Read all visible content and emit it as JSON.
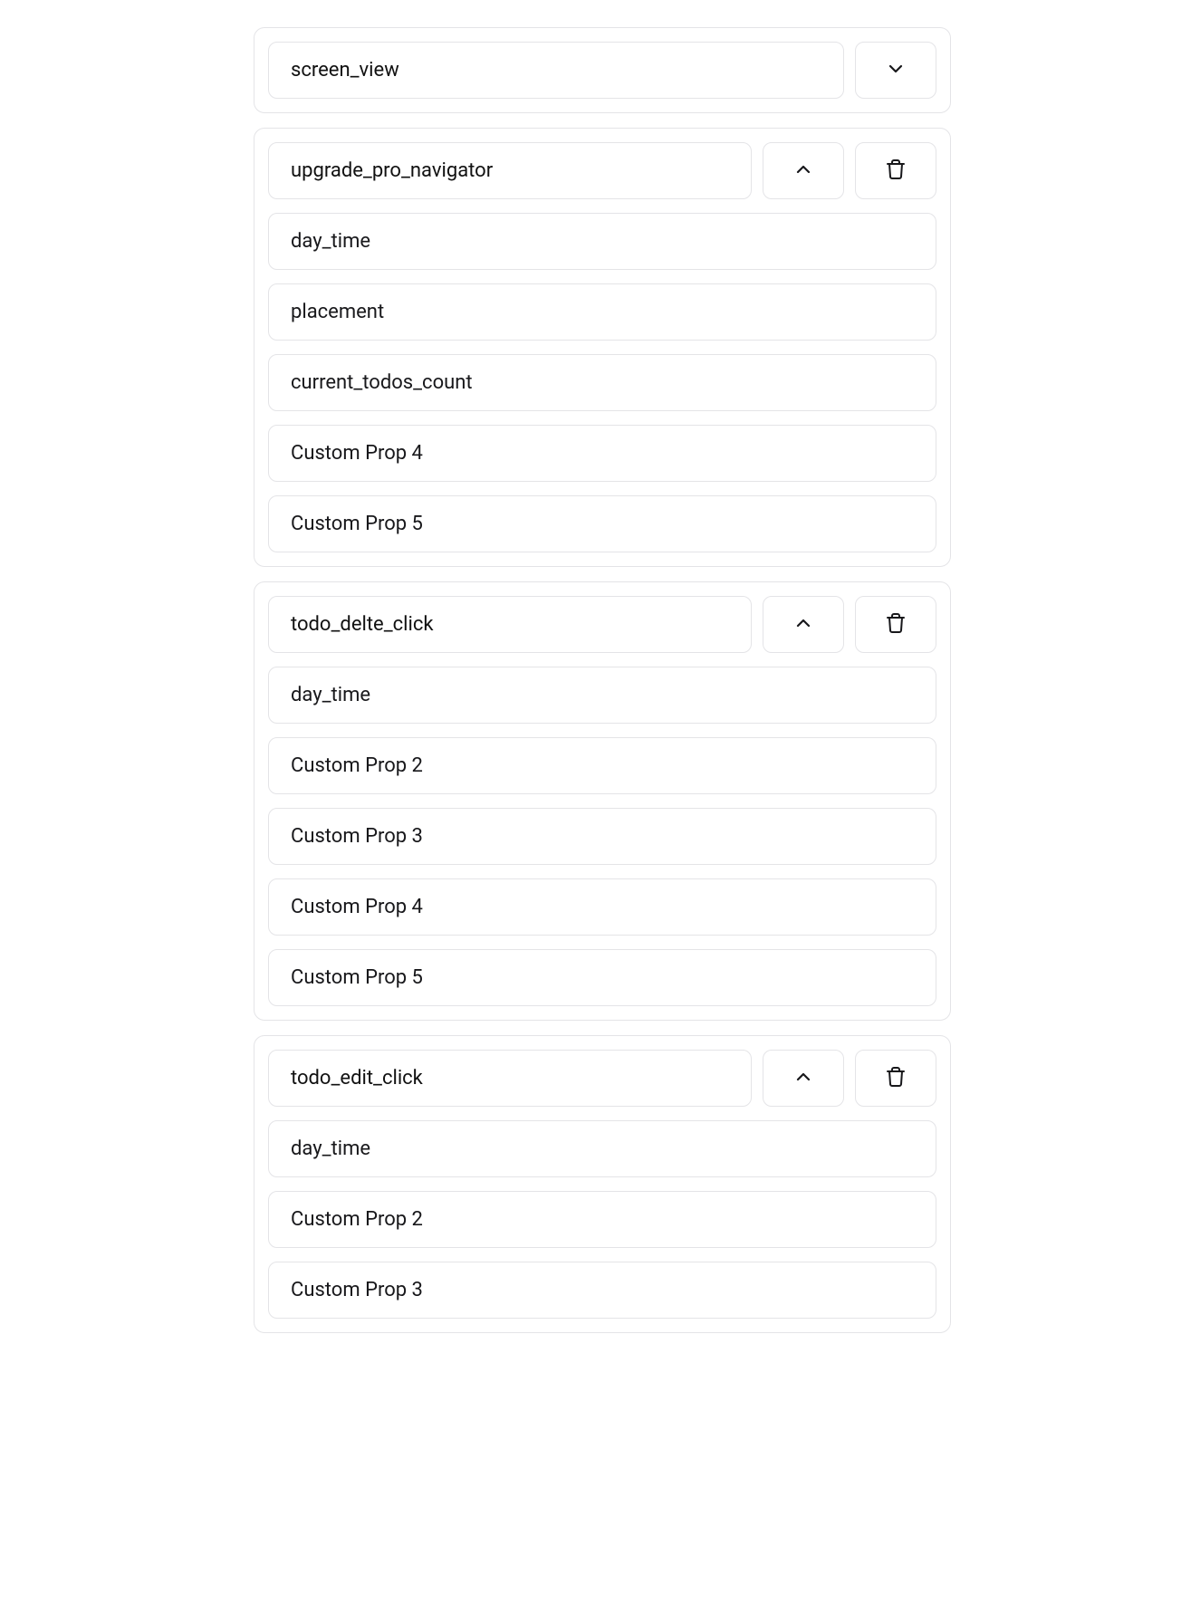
{
  "events": [
    {
      "name": "screen_view",
      "expanded": false,
      "deletable": false,
      "props": []
    },
    {
      "name": "upgrade_pro_navigator",
      "expanded": true,
      "deletable": true,
      "props": [
        "day_time",
        "placement",
        "current_todos_count",
        "Custom Prop 4",
        "Custom Prop 5"
      ]
    },
    {
      "name": "todo_delte_click",
      "expanded": true,
      "deletable": true,
      "props": [
        "day_time",
        "Custom Prop 2",
        "Custom Prop 3",
        "Custom Prop 4",
        "Custom Prop 5"
      ]
    },
    {
      "name": "todo_edit_click",
      "expanded": true,
      "deletable": true,
      "props": [
        "day_time",
        "Custom Prop 2",
        "Custom Prop 3"
      ]
    }
  ]
}
